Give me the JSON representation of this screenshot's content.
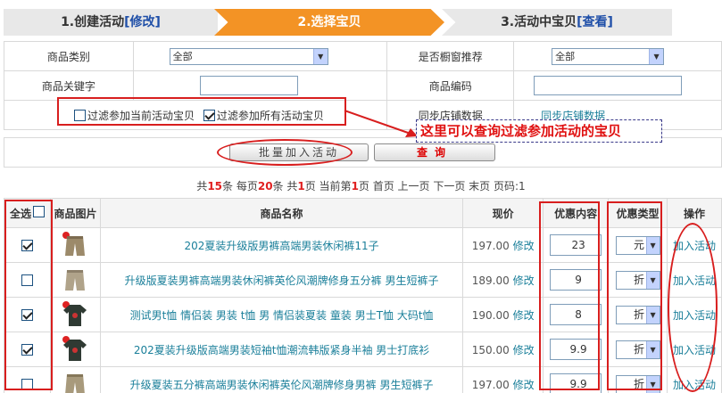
{
  "steps": [
    {
      "label": "1.创建活动",
      "link": "[修改]"
    },
    {
      "label": "2.选择宝贝",
      "link": ""
    },
    {
      "label": "3.活动中宝贝",
      "link": "[查看]"
    }
  ],
  "filters": {
    "category_label": "商品类别",
    "category_value": "全部",
    "showcase_label": "是否橱窗推荐",
    "showcase_value": "全部",
    "keyword_label": "商品关键字",
    "code_label": "商品编码",
    "filter_current_label": "过滤参加当前活动宝贝",
    "filter_all_label": "过滤参加所有活动宝贝",
    "sync_label": "同步店铺数据",
    "sync_link": "同步店铺数据"
  },
  "buttons": {
    "batch": "批量加入活动",
    "query": "查询"
  },
  "annotation_note": "这里可以查询过滤参加活动的宝贝",
  "pager": {
    "p1": "共",
    "total": "15",
    "p2": "条 每页",
    "per": "20",
    "p3": "条 共",
    "pages": "1",
    "p4": "页 当前第",
    "cur": "1",
    "p5": "页 首页 上一页 下一页 末页 页码:1"
  },
  "grid": {
    "headers": {
      "select_all": "全选",
      "image": "商品图片",
      "name": "商品名称",
      "price": "现价",
      "discount": "优惠内容",
      "type": "优惠类型",
      "action": "操作"
    },
    "rows": [
      {
        "name": "202夏装升级版男裤高端男装休闲裤11子",
        "price": "197.00",
        "edit": "修改",
        "discount": "23",
        "type": "元",
        "action": "加入活动"
      },
      {
        "name": "升级版夏装男裤高端男装休闲裤英伦风潮牌修身五分裤 男生短裤子",
        "price": "189.00",
        "edit": "修改",
        "discount": "9",
        "type": "折",
        "action": "加入活动"
      },
      {
        "name": "测试男t恤 情侣装 男装 t恤 男 情侣装夏装 童装 男士T恤 大码t恤",
        "price": "190.00",
        "edit": "修改",
        "discount": "8",
        "type": "折",
        "action": "加入活动"
      },
      {
        "name": "202夏装升级版高端男装短袖t恤潮流韩版紧身半袖 男士打底衫",
        "price": "150.00",
        "edit": "修改",
        "discount": "9.9",
        "type": "折",
        "action": "加入活动"
      },
      {
        "name": "升级夏装五分裤高端男装休闲裤英伦风潮牌修身男裤 男生短裤子",
        "price": "197.00",
        "edit": "修改",
        "discount": "9.9",
        "type": "折",
        "action": "加入活动"
      }
    ]
  },
  "colors": {
    "active_step": "#f39325",
    "annotation_red": "#d81e1e",
    "link": "#1a7f9a"
  }
}
